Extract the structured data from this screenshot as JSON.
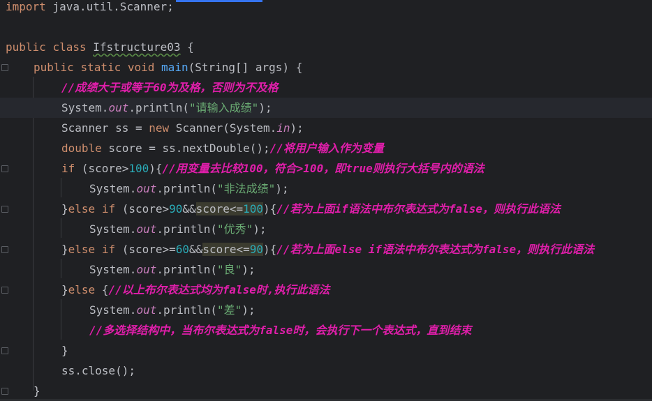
{
  "colors": {
    "background": "#1f2023",
    "keyword": "#cf8e6d",
    "string": "#6aab73",
    "number": "#2aacb8",
    "comment": "#e01eaa",
    "field": "#c77dbb",
    "method": "#56a8f5",
    "text": "#bcbec4"
  },
  "code": {
    "l1": {
      "kw": "import",
      "rest": " java.util.Scanner;"
    },
    "l3": {
      "kw1": "public",
      "kw2": "class",
      "name": "Ifstructure03",
      "rest": " {"
    },
    "l4": {
      "kw1": "public",
      "kw2": "static",
      "kw3": "void",
      "fn": "main",
      "rest": "(String[] args) {"
    },
    "l5": {
      "cmt": "//成绩大于或等于60为及格，否则为不及格"
    },
    "l6": {
      "a": "System.",
      "f": "out",
      "b": ".println(",
      "s": "\"请输入成绩\"",
      "c": ");"
    },
    "l7": {
      "a": "Scanner ss = ",
      "kw": "new",
      "b": " Scanner(System.",
      "f": "in",
      "c": ");"
    },
    "l8": {
      "kw": "double",
      "a": " score = ss.nextDouble();",
      "cmt": "//将用户输入作为变量"
    },
    "l9": {
      "kw": "if",
      "a": " (score>",
      "n": "100",
      "b": "){",
      "cmt": "//用变量去比较100，符合>100，即true则执行大括号内的语法"
    },
    "l10": {
      "a": "System.",
      "f": "out",
      "b": ".println(",
      "s": "\"非法成绩\"",
      "c": ");"
    },
    "l11": {
      "a": "}",
      "kw1": "else",
      "kw2": "if",
      "b": " (score>",
      "n1": "90",
      "c": "&&",
      "h": "score<=",
      "n2": "100",
      "d": "){",
      "cmt": "//若为上面if语法中布尔表达式为false，则执行此语法"
    },
    "l12": {
      "a": "System.",
      "f": "out",
      "b": ".println(",
      "s": "\"优秀\"",
      "c": ");"
    },
    "l13": {
      "a": "}",
      "kw1": "else",
      "kw2": "if",
      "b": " (score>=",
      "n1": "60",
      "c": "&&",
      "h": "score<=",
      "n2": "90",
      "d": "){",
      "cmt": "//若为上面else if语法中布尔表达式为false，则执行此语法"
    },
    "l14": {
      "a": "System.",
      "f": "out",
      "b": ".println(",
      "s": "\"良\"",
      "c": ");"
    },
    "l15": {
      "a": "}",
      "kw": "else",
      "b": " {",
      "cmt": "//以上布尔表达式均为false时,执行此语法"
    },
    "l16": {
      "a": "System.",
      "f": "out",
      "b": ".println(",
      "s": "\"差\"",
      "c": ");"
    },
    "l17": {
      "cmt": "//多选择结构中，当布尔表达式为false时，会执行下一个表达式，直到结束"
    },
    "l18": {
      "a": "}"
    },
    "l19": {
      "a": "ss.close();"
    },
    "l20": {
      "a": "}"
    }
  }
}
